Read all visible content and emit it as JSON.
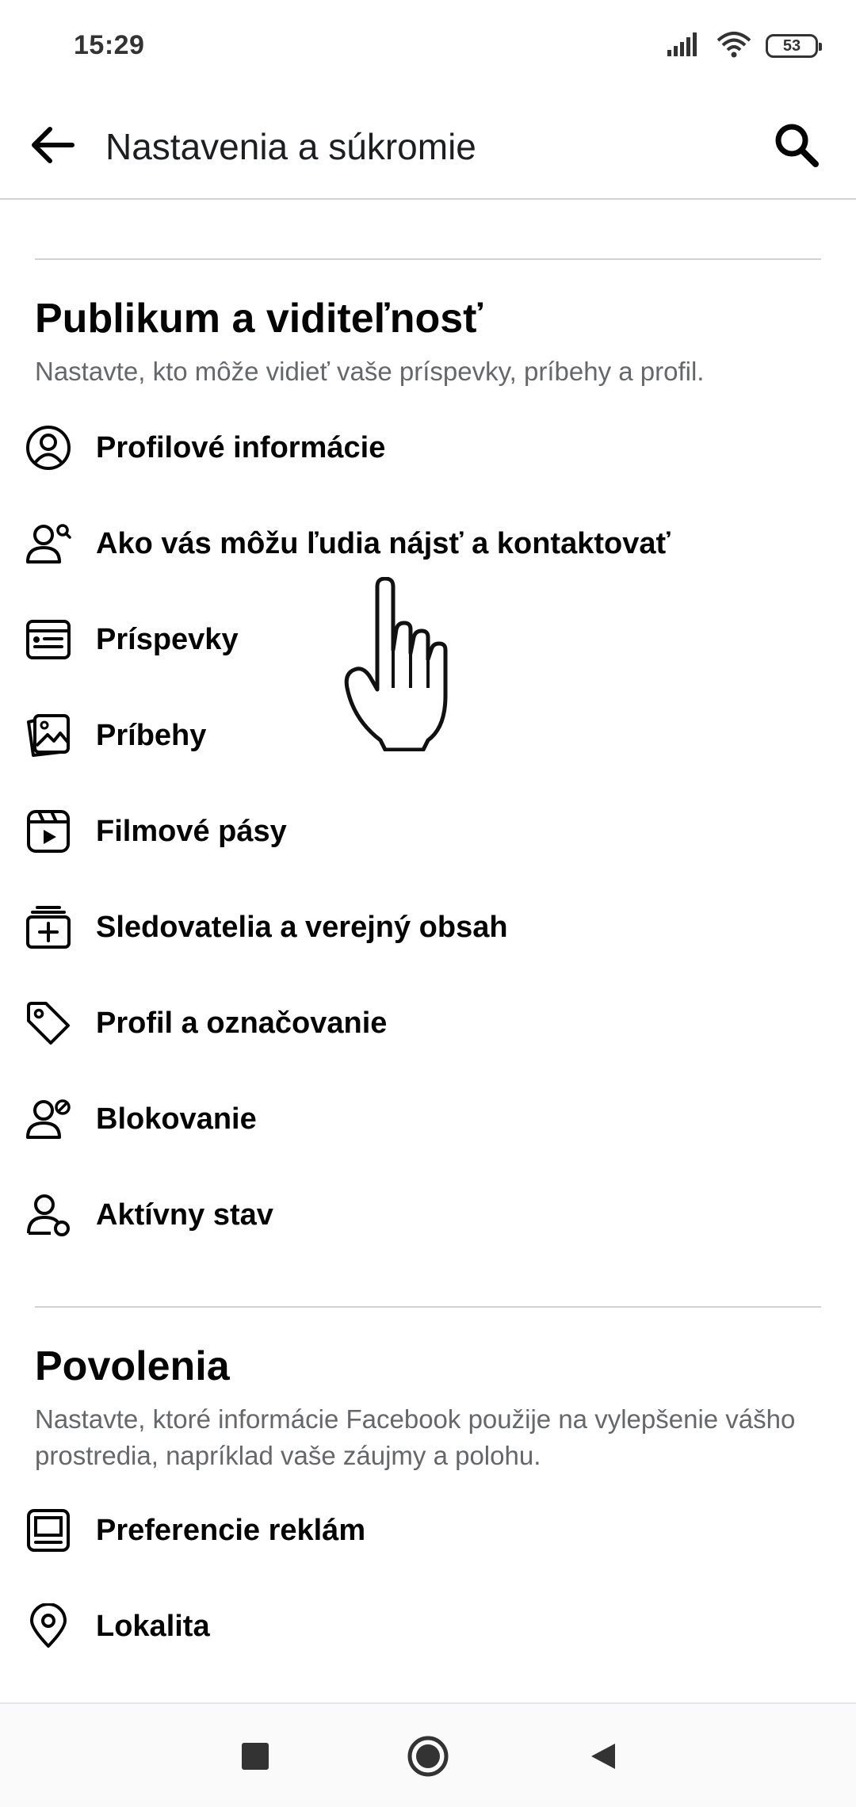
{
  "status_bar": {
    "time": "15:29",
    "battery": "53",
    "icons": [
      "signal-icon",
      "wifi-icon",
      "battery-icon"
    ]
  },
  "header": {
    "title": "Nastavenia a súkromie",
    "back_icon": "arrow-left-icon",
    "search_icon": "search-icon"
  },
  "sections": [
    {
      "title": "Publikum a viditeľnosť",
      "description": "Nastavte, kto môže vidieť vaše príspevky, príbehy a profil.",
      "items": [
        {
          "label": "Profilové informácie",
          "icon": "profile-circle-icon"
        },
        {
          "label": "Ako vás môžu ľudia nájsť a kontaktovať",
          "icon": "people-search-icon"
        },
        {
          "label": "Príspevky",
          "icon": "posts-icon"
        },
        {
          "label": "Príbehy",
          "icon": "stories-icon"
        },
        {
          "label": "Filmové pásy",
          "icon": "reels-icon"
        },
        {
          "label": "Sledovatelia a verejný obsah",
          "icon": "followers-icon"
        },
        {
          "label": "Profil a označovanie",
          "icon": "tag-icon"
        },
        {
          "label": "Blokovanie",
          "icon": "block-user-icon"
        },
        {
          "label": "Aktívny stav",
          "icon": "active-status-icon"
        }
      ]
    },
    {
      "title": "Povolenia",
      "description": "Nastavte, ktoré informácie Facebook použije na vylepšenie vášho prostredia, napríklad vaše záujmy a polohu.",
      "items": [
        {
          "label": "Preferencie reklám",
          "icon": "ad-preferences-icon"
        },
        {
          "label": "Lokalita",
          "icon": "location-pin-icon"
        }
      ]
    }
  ],
  "nav_bar": {
    "icons": [
      "recent-apps-icon",
      "home-icon",
      "back-triangle-icon"
    ]
  }
}
